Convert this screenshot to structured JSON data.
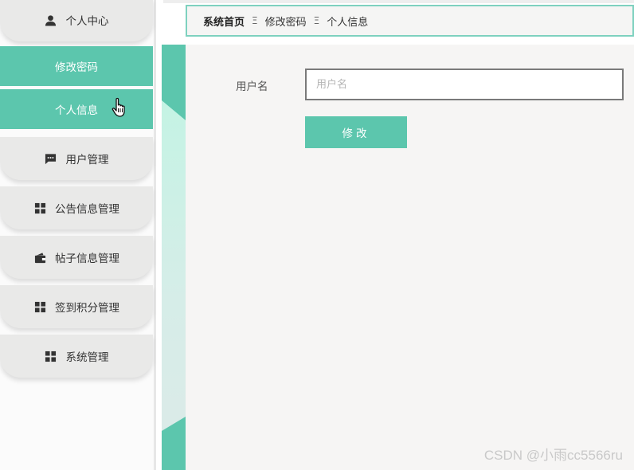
{
  "sidebar": {
    "items": [
      {
        "label": "个人中心",
        "icon": "user-icon"
      },
      {
        "label": "修改密码"
      },
      {
        "label": "个人信息"
      },
      {
        "label": "用户管理",
        "icon": "message-icon"
      },
      {
        "label": "公告信息管理",
        "icon": "grid-icon"
      },
      {
        "label": "帖子信息管理",
        "icon": "wallet-icon"
      },
      {
        "label": "签到积分管理",
        "icon": "grid-icon"
      },
      {
        "label": "系统管理",
        "icon": "grid-icon"
      }
    ]
  },
  "breadcrumb": {
    "home": "系统首页",
    "separator": "Ξ",
    "level1": "修改密码",
    "level2": "个人信息"
  },
  "form": {
    "username_label": "用户名",
    "username_placeholder": "用户名",
    "username_value": "",
    "submit_label": "修改"
  },
  "watermark": "CSDN @小雨cc5566ru",
  "colors": {
    "accent": "#5cc6ad",
    "border_accent": "#7ed1bf",
    "menu_bg": "#e9e9e8",
    "content_bg": "#f6f5f4"
  }
}
